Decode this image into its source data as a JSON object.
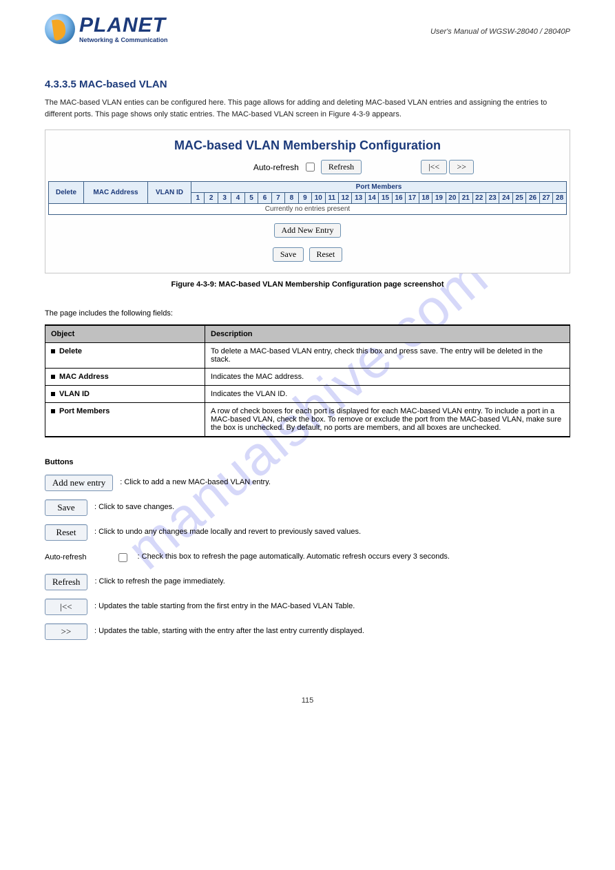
{
  "logo": {
    "brand": "PLANET",
    "tagline": "Networking & Communication"
  },
  "header_meta": "User's Manual of WGSW-28040 / 28040P",
  "watermark": "manualshive.com",
  "section_heading": "4.3.3.5 MAC-based VLAN",
  "intro": "The MAC-based VLAN enties can be configured here. This page allows for adding and deleting MAC-based VLAN entries and assigning the entries to different ports. This page shows only static entries. The MAC-based VLAN screen in Figure 4-3-9 appears.",
  "panel": {
    "title": "MAC-based VLAN Membership Configuration",
    "auto_refresh_label": "Auto-refresh",
    "refresh": "Refresh",
    "first": "|<<",
    "next": ">>",
    "save": "Save",
    "reset": "Reset",
    "add_new": "Add New Entry",
    "cols": {
      "delete": "Delete",
      "mac": "MAC Address",
      "vlan": "VLAN ID",
      "port_members": "Port Members"
    },
    "ports": [
      "1",
      "2",
      "3",
      "4",
      "5",
      "6",
      "7",
      "8",
      "9",
      "10",
      "11",
      "12",
      "13",
      "14",
      "15",
      "16",
      "17",
      "18",
      "19",
      "20",
      "21",
      "22",
      "23",
      "24",
      "25",
      "26",
      "27",
      "28"
    ],
    "nodata": "Currently no entries present"
  },
  "figcap": "Figure 4-3-9: MAC-based VLAN Membership Configuration page screenshot",
  "desc_text": "The page includes the following fields:",
  "params": {
    "head_obj": "Object",
    "head_desc": "Description",
    "rows": [
      {
        "obj": "Delete",
        "desc": "To delete a MAC-based VLAN entry, check this box and press save. The entry will be deleted in the stack."
      },
      {
        "obj": "MAC Address",
        "desc": "Indicates the MAC address."
      },
      {
        "obj": "VLAN ID",
        "desc": "Indicates the VLAN ID."
      },
      {
        "obj": "Port Members",
        "desc": "A row of check boxes for each port is displayed for each MAC-based VLAN entry. To include a port in a MAC-based VLAN, check the box. To remove or exclude the port from the MAC-based VLAN, make sure the box is unchecked. By default, no ports are members, and all boxes are unchecked."
      }
    ]
  },
  "buttons": {
    "heading": "Buttons",
    "rows": [
      {
        "kind": "btn",
        "btn": "Add new entry",
        "text": ": Click to add a new MAC-based VLAN entry."
      },
      {
        "kind": "btn",
        "btn": "Save",
        "text": ": Click to save changes."
      },
      {
        "kind": "btn",
        "btn": "Reset",
        "text": ": Click to undo any changes made locally and revert to previously saved values."
      },
      {
        "kind": "checkbox",
        "prefix": "Auto-refresh",
        "text": ": Check this box to refresh the page automatically. Automatic refresh occurs every 3 seconds."
      },
      {
        "kind": "btn",
        "btn": "Refresh",
        "text": ": Click to refresh the page immediately."
      },
      {
        "kind": "btn",
        "btn": "|<<",
        "text": ": Updates the table starting from the first entry in the MAC-based VLAN Table."
      },
      {
        "kind": "btn",
        "btn": ">>",
        "text": ": Updates the table, starting with the entry after the last entry currently displayed."
      }
    ]
  },
  "footer": "115"
}
